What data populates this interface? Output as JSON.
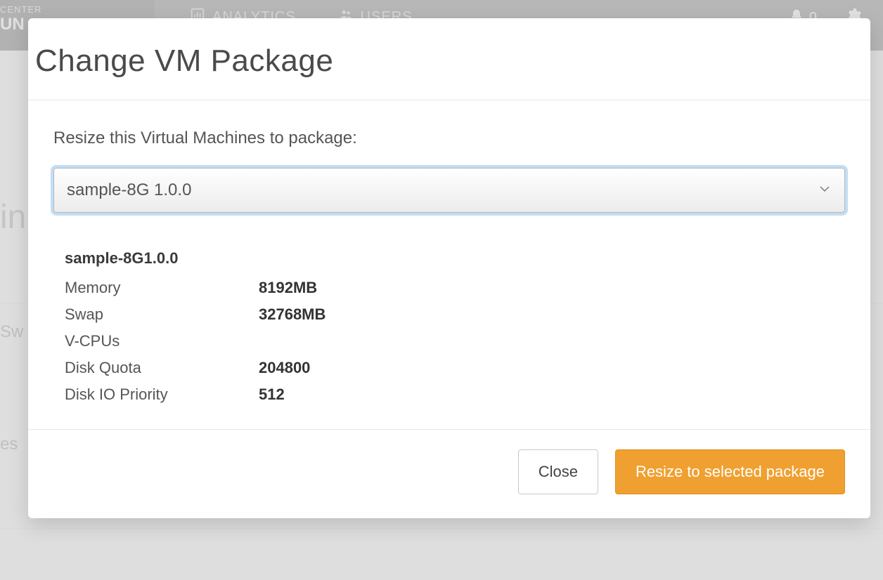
{
  "nav": {
    "brand_top": "CENTER",
    "brand_bottom": "UN",
    "links": {
      "analytics": "ANALYTICS",
      "users": "USERS"
    },
    "notif_count": "0"
  },
  "bg": {
    "headline_fragment": "in",
    "row_swap": "Sw",
    "row_es": "es"
  },
  "modal": {
    "title": "Change VM Package",
    "prompt": "Resize this Virtual Machines to package:",
    "select": {
      "value": "sample-8G 1.0.0"
    },
    "package": {
      "title": "sample-8G1.0.0",
      "specs": {
        "memory_label": "Memory",
        "memory_value": "8192MB",
        "swap_label": "Swap",
        "swap_value": "32768MB",
        "vcpus_label": "V-CPUs",
        "vcpus_value": "",
        "disk_quota_label": "Disk Quota",
        "disk_quota_value": "204800",
        "disk_io_label": "Disk IO Priority",
        "disk_io_value": "512"
      }
    },
    "buttons": {
      "close": "Close",
      "resize": "Resize to selected package"
    }
  }
}
